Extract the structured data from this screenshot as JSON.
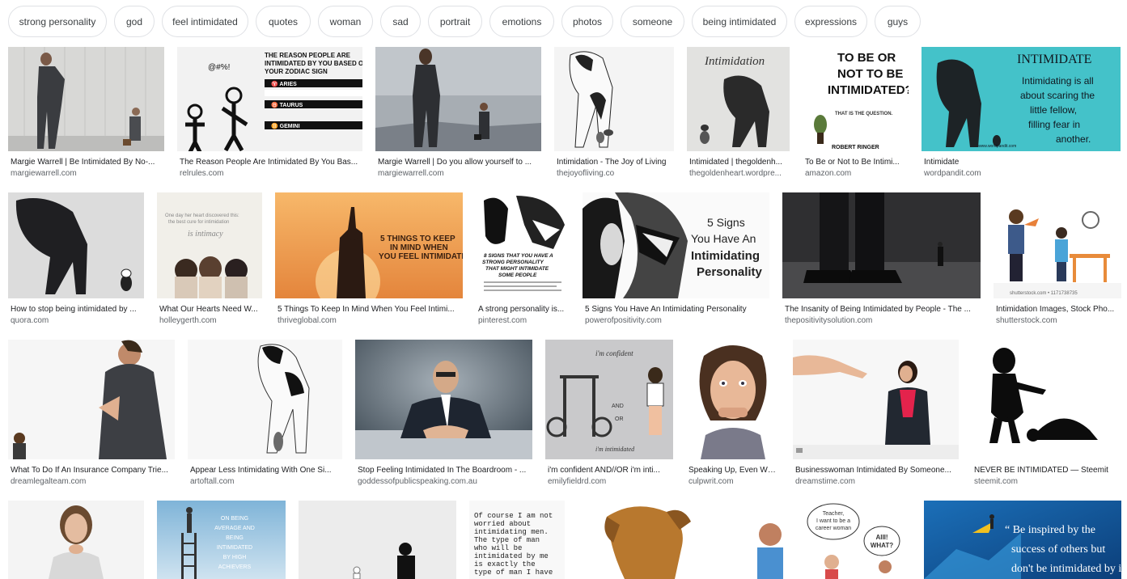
{
  "chips": [
    "strong personality",
    "god",
    "feel intimidated",
    "quotes",
    "woman",
    "sad",
    "portrait",
    "emotions",
    "photos",
    "someone",
    "being intimidated",
    "expressions",
    "guys"
  ],
  "results": [
    {
      "title": "Margie Warrell | Be Intimidated By No-...",
      "source": "margiewarrell.com"
    },
    {
      "title": "The Reason People Are Intimidated By You Bas...",
      "source": "relrules.com"
    },
    {
      "title": "Margie Warrell | Do you allow yourself to ...",
      "source": "margiewarrell.com"
    },
    {
      "title": "Intimidation - The Joy of Living",
      "source": "thejoyofliving.co"
    },
    {
      "title": "Intimidated | thegoldenh...",
      "source": "thegoldenheart.wordpre..."
    },
    {
      "title": "To Be or Not to Be Intimi...",
      "source": "amazon.com"
    },
    {
      "title": "Intimidate",
      "source": "wordpandit.com"
    },
    {
      "title": "How to stop being intimidated by ...",
      "source": "quora.com"
    },
    {
      "title": "What Our Hearts Need W...",
      "source": "holleygerth.com"
    },
    {
      "title": "5 Things To Keep In Mind When You Feel Intimi...",
      "source": "thriveglobal.com"
    },
    {
      "title": "A strong personality is...",
      "source": "pinterest.com"
    },
    {
      "title": "5 Signs You Have An Intimidating Personality",
      "source": "powerofpositivity.com"
    },
    {
      "title": "The Insanity of Being Intimidated by People - The ...",
      "source": "thepositivitysolution.com"
    },
    {
      "title": "Intimidation Images, Stock Pho...",
      "source": "shutterstock.com"
    },
    {
      "title": "What To Do If An Insurance Company Trie...",
      "source": "dreamlegalteam.com"
    },
    {
      "title": "Appear Less Intimidating With One Si...",
      "source": "artoftall.com"
    },
    {
      "title": "Stop Feeling Intimidated In The Boardroom - ...",
      "source": "goddessofpublicspeaking.com.au"
    },
    {
      "title": "i'm confident AND//OR i'm inti...",
      "source": "emilyfieldrd.com"
    },
    {
      "title": "Speaking Up, Even Wh...",
      "source": "culpwrit.com"
    },
    {
      "title": "Businesswoman Intimidated By Someone...",
      "source": "dreamstime.com"
    },
    {
      "title": "NEVER BE INTIMIDATED — Steemit",
      "source": "steemit.com"
    }
  ],
  "image_text": {
    "r1_zodiac_title": "THE REASON PEOPLE ARE INTIMIDATED BY YOU BASED ON YOUR ZODIAC SIGN",
    "r1_aries": "ARIES",
    "r1_taurus": "TAURUS",
    "r1_gemini": "GEMINI",
    "r1_intimidation": "Intimidation",
    "r1_book_title": "TO BE OR NOT TO BE INTIMIDATED?",
    "r1_book_sub": "THAT IS THE QUESTION.",
    "r1_book_author": "ROBERT RINGER",
    "r1_word_title": "INTIMIDATE",
    "r1_word_body": "Intimidating is all about scaring the little fellow, filling fear in another.",
    "r1_word_url": "www.wordpandit.com",
    "r2_hearts": "One day her heart discovered this: the best cure for intimidation",
    "r2_hearts_script": "is intimacy",
    "r2_thrive": "5 THINGS TO KEEP IN MIND WHEN YOU FEEL INTIMIDATED",
    "r2_pinterest": "8 SIGNS THAT YOU HAVE A STRONG PERSONALITY THAT MIGHT INTIMIDATE SOME PEOPLE",
    "r2_signs_1": "5 Signs",
    "r2_signs_2": "You Have An",
    "r2_signs_3": "Intimidating",
    "r2_signs_4": "Personality",
    "r2_shutter": "shutterstock.com • 1171738735",
    "r3_confident": "i'm confident",
    "r3_and": "AND",
    "r3_or": "OR",
    "r3_intimidated": "i'm intimidated",
    "r4_average": "On Being Average And Being Intimidated By High Achievers",
    "r4_quote": "Of course I am not worried about intimidating men. The type of man who will be intimidated by me is exactly the type of man I have",
    "r4_bubble1": "Teacher, I want to be a career woman after school!",
    "r4_bubble2": "AIII! WHAT?",
    "r4_inspire": "\" Be inspired by the success of others but don't be intimidated by it. \""
  }
}
